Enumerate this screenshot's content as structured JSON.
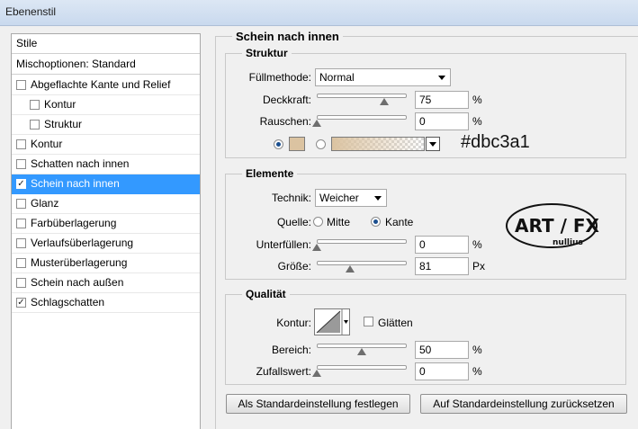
{
  "window": {
    "title": "Ebenenstil"
  },
  "left": {
    "header": "Stile",
    "blend_options": "Mischoptionen: Standard",
    "items": [
      {
        "label": "Abgeflachte Kante und Relief",
        "checked": false,
        "indent": false,
        "selected": false
      },
      {
        "label": "Kontur",
        "checked": false,
        "indent": true,
        "selected": false
      },
      {
        "label": "Struktur",
        "checked": false,
        "indent": true,
        "selected": false
      },
      {
        "label": "Kontur",
        "checked": false,
        "indent": false,
        "selected": false
      },
      {
        "label": "Schatten nach innen",
        "checked": false,
        "indent": false,
        "selected": false
      },
      {
        "label": "Schein nach innen",
        "checked": true,
        "indent": false,
        "selected": true
      },
      {
        "label": "Glanz",
        "checked": false,
        "indent": false,
        "selected": false
      },
      {
        "label": "Farbüberlagerung",
        "checked": false,
        "indent": false,
        "selected": false
      },
      {
        "label": "Verlaufsüberlagerung",
        "checked": false,
        "indent": false,
        "selected": false
      },
      {
        "label": "Musterüberlagerung",
        "checked": false,
        "indent": false,
        "selected": false
      },
      {
        "label": "Schein nach außen",
        "checked": false,
        "indent": false,
        "selected": false
      },
      {
        "label": "Schlagschatten",
        "checked": true,
        "indent": false,
        "selected": false
      }
    ]
  },
  "main": {
    "title": "Schein nach innen",
    "struktur": {
      "title": "Struktur",
      "fill_method_label": "Füllmethode:",
      "fill_method_value": "Normal",
      "opacity_label": "Deckkraft:",
      "opacity_value": "75",
      "opacity_unit": "%",
      "opacity_fraction": 0.75,
      "noise_label": "Rauschen:",
      "noise_value": "0",
      "noise_unit": "%",
      "noise_fraction": 0,
      "color_radio_selected": "solid",
      "glow_color": "#dbc3a1",
      "hex_annotation": "#dbc3a1"
    },
    "elemente": {
      "title": "Elemente",
      "technique_label": "Technik:",
      "technique_value": "Weicher",
      "source_label": "Quelle:",
      "source_center": "Mitte",
      "source_edge": "Kante",
      "source_selected": "Kante",
      "choke_label": "Unterfüllen:",
      "choke_value": "0",
      "choke_unit": "%",
      "size_label": "Größe:",
      "size_value": "81",
      "size_unit": "Px",
      "logo_text_top": "ART / FX",
      "logo_text_bottom": "nullius"
    },
    "qualitaet": {
      "title": "Qualität",
      "contour_label": "Kontur:",
      "antialias_label": "Glätten",
      "antialias_checked": false,
      "range_label": "Bereich:",
      "range_value": "50",
      "range_unit": "%",
      "range_fraction": 0.5,
      "jitter_label": "Zufallswert:",
      "jitter_value": "0",
      "jitter_unit": "%",
      "jitter_fraction": 0
    },
    "buttons": {
      "make_default": "Als Standardeinstellung festlegen",
      "reset_default": "Auf Standardeinstellung zurücksetzen"
    }
  }
}
